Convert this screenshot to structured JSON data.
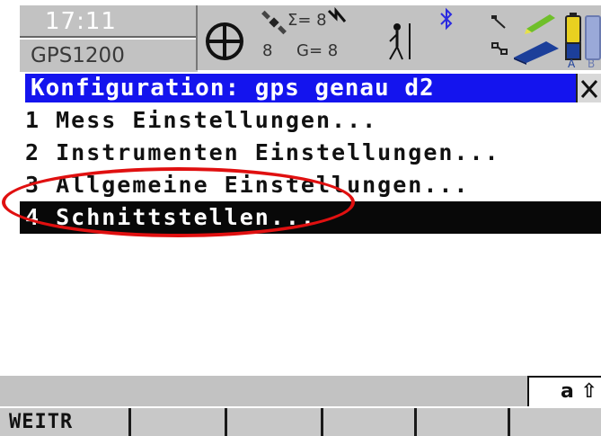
{
  "status": {
    "time": "17:11",
    "device": "GPS1200",
    "satellites_tracked": "8",
    "sigma": "Σ= 8",
    "glonass": "G= 8"
  },
  "title": "Konfiguration: gps genau d2",
  "menu": {
    "items": [
      {
        "label": "1 Mess Einstellungen..."
      },
      {
        "label": "2 Instrumenten Einstellungen..."
      },
      {
        "label": "3 Allgemeine Einstellungen..."
      },
      {
        "label": "4 Schnittstellen..."
      }
    ],
    "selected_index": 3
  },
  "input_mode": "a ⇧",
  "fkeys": [
    "WEITR",
    "",
    "",
    "",
    "",
    ""
  ],
  "colors": {
    "title_bg": "#1414ee",
    "panel_gray": "#c2c2c2",
    "annotation": "#e01010",
    "selected_bg": "#080808"
  }
}
